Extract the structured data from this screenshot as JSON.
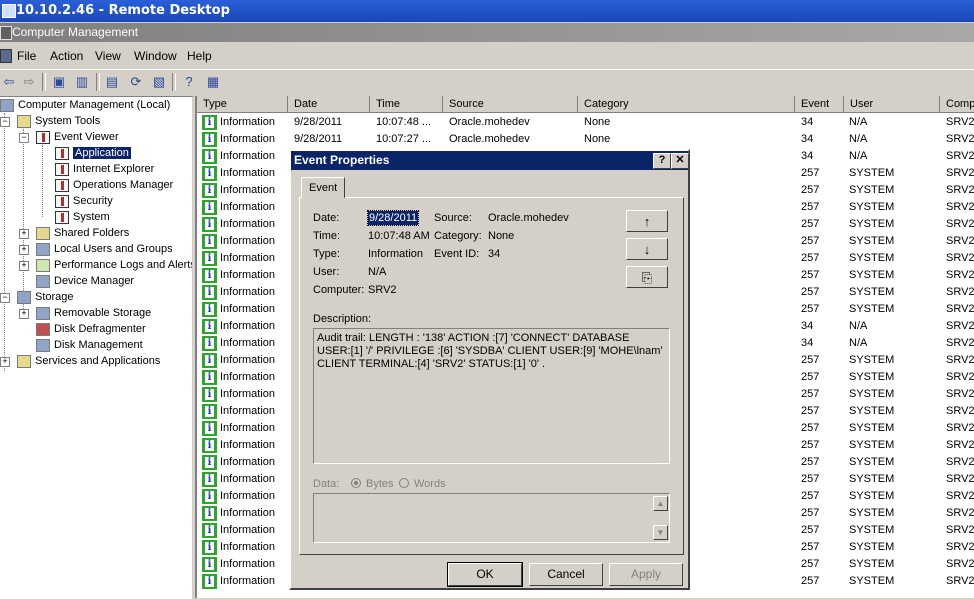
{
  "remote_desktop": {
    "title": "10.10.2.46 - Remote Desktop"
  },
  "app": {
    "title": "Computer Management"
  },
  "menu": [
    "File",
    "Action",
    "View",
    "Window",
    "Help"
  ],
  "tree": {
    "items": [
      {
        "label": "Computer Management (Local)"
      },
      {
        "label": "System Tools"
      },
      {
        "label": "Event Viewer"
      },
      {
        "label": "Application"
      },
      {
        "label": "Internet Explorer"
      },
      {
        "label": "Operations Manager"
      },
      {
        "label": "Security"
      },
      {
        "label": "System"
      },
      {
        "label": "Shared Folders"
      },
      {
        "label": "Local Users and Groups"
      },
      {
        "label": "Performance Logs and Alerts"
      },
      {
        "label": "Device Manager"
      },
      {
        "label": "Storage"
      },
      {
        "label": "Removable Storage"
      },
      {
        "label": "Disk Defragmenter"
      },
      {
        "label": "Disk Management"
      },
      {
        "label": "Services and Applications"
      }
    ]
  },
  "list": {
    "columns": [
      "Type",
      "Date",
      "Time",
      "Source",
      "Category",
      "Event",
      "User",
      "Computer"
    ],
    "rows": [
      {
        "type": "Information",
        "date": "9/28/2011",
        "time": "10:07:48 ...",
        "source": "Oracle.mohedev",
        "category": "None",
        "event": "34",
        "user": "N/A",
        "computer": "SRV2"
      },
      {
        "type": "Information",
        "date": "9/28/2011",
        "time": "10:07:27 ...",
        "source": "Oracle.mohedev",
        "category": "None",
        "event": "34",
        "user": "N/A",
        "computer": "SRV2"
      },
      {
        "type": "Information",
        "event": "34",
        "user": "N/A",
        "computer": "SRV2"
      },
      {
        "type": "Information",
        "event": "257",
        "user": "SYSTEM",
        "computer": "SRV2"
      },
      {
        "type": "Information",
        "event": "257",
        "user": "SYSTEM",
        "computer": "SRV2"
      },
      {
        "type": "Information",
        "event": "257",
        "user": "SYSTEM",
        "computer": "SRV2"
      },
      {
        "type": "Information",
        "event": "257",
        "user": "SYSTEM",
        "computer": "SRV2"
      },
      {
        "type": "Information",
        "event": "257",
        "user": "SYSTEM",
        "computer": "SRV2"
      },
      {
        "type": "Information",
        "event": "257",
        "user": "SYSTEM",
        "computer": "SRV2"
      },
      {
        "type": "Information",
        "event": "257",
        "user": "SYSTEM",
        "computer": "SRV2"
      },
      {
        "type": "Information",
        "event": "257",
        "user": "SYSTEM",
        "computer": "SRV2"
      },
      {
        "type": "Information",
        "event": "257",
        "user": "SYSTEM",
        "computer": "SRV2"
      },
      {
        "type": "Information",
        "event": "34",
        "user": "N/A",
        "computer": "SRV2"
      },
      {
        "type": "Information",
        "event": "34",
        "user": "N/A",
        "computer": "SRV2"
      },
      {
        "type": "Information",
        "event": "257",
        "user": "SYSTEM",
        "computer": "SRV2"
      },
      {
        "type": "Information",
        "event": "257",
        "user": "SYSTEM",
        "computer": "SRV2"
      },
      {
        "type": "Information",
        "event": "257",
        "user": "SYSTEM",
        "computer": "SRV2"
      },
      {
        "type": "Information",
        "event": "257",
        "user": "SYSTEM",
        "computer": "SRV2"
      },
      {
        "type": "Information",
        "event": "257",
        "user": "SYSTEM",
        "computer": "SRV2"
      },
      {
        "type": "Information",
        "event": "257",
        "user": "SYSTEM",
        "computer": "SRV2"
      },
      {
        "type": "Information",
        "event": "257",
        "user": "SYSTEM",
        "computer": "SRV2"
      },
      {
        "type": "Information",
        "event": "257",
        "user": "SYSTEM",
        "computer": "SRV2"
      },
      {
        "type": "Information",
        "event": "257",
        "user": "SYSTEM",
        "computer": "SRV2"
      },
      {
        "type": "Information",
        "event": "257",
        "user": "SYSTEM",
        "computer": "SRV2"
      },
      {
        "type": "Information",
        "event": "257",
        "user": "SYSTEM",
        "computer": "SRV2"
      },
      {
        "type": "Information",
        "event": "257",
        "user": "SYSTEM",
        "computer": "SRV2"
      },
      {
        "type": "Information",
        "event": "257",
        "user": "SYSTEM",
        "computer": "SRV2"
      },
      {
        "type": "Information",
        "event": "257",
        "user": "SYSTEM",
        "computer": "SRV2"
      }
    ]
  },
  "dialog": {
    "title": "Event Properties",
    "help_button": "?",
    "close_button": "✕",
    "tab": "Event",
    "labels": {
      "date": "Date:",
      "source": "Source:",
      "time": "Time:",
      "category": "Category:",
      "type": "Type:",
      "event_id": "Event ID:",
      "user": "User:",
      "computer": "Computer:",
      "description": "Description:",
      "data": "Data:",
      "bytes": "Bytes",
      "words": "Words"
    },
    "values": {
      "date": "9/28/2011",
      "source": "Oracle.mohedev",
      "time": "10:07:48 AM",
      "category": "None",
      "type": "Information",
      "event_id": "34",
      "user": "N/A",
      "computer": "SRV2"
    },
    "description": "Audit trail: LENGTH : '138' ACTION :[7] 'CONNECT' DATABASE USER:[1] '/' PRIVILEGE :[6] 'SYSDBA' CLIENT USER:[9] 'MOHE\\lnam' CLIENT TERMINAL:[4] 'SRV2' STATUS:[1] '0' .",
    "buttons": {
      "ok": "OK",
      "cancel": "Cancel",
      "apply": "Apply"
    },
    "nav_icons": {
      "up": "↑",
      "down": "↓",
      "copy": "⎘"
    }
  }
}
